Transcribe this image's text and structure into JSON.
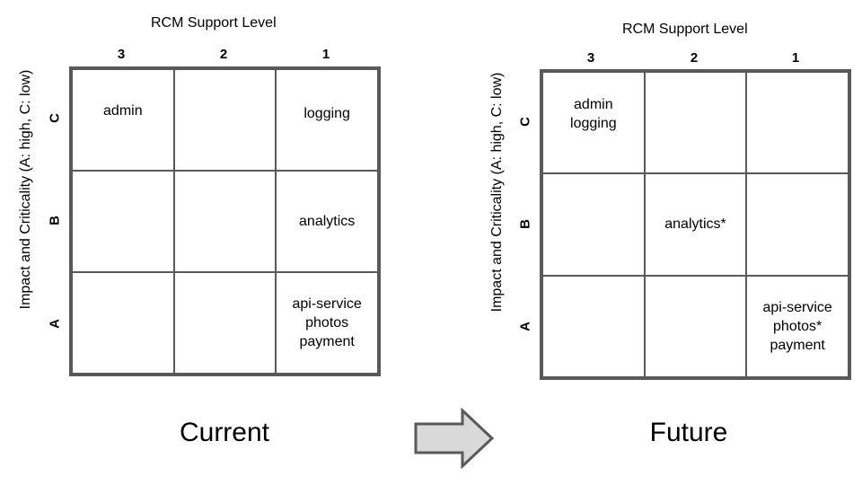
{
  "x_axis_title": "RCM Support Level",
  "y_axis_title": "Impact and Criticality (A: high, C: low)",
  "columns": [
    "3",
    "2",
    "1"
  ],
  "rows": [
    "C",
    "B",
    "A"
  ],
  "panels": [
    {
      "caption": "Current",
      "cells": [
        [
          [
            "admin"
          ],
          [],
          [
            "logging"
          ]
        ],
        [
          [],
          [],
          [
            "analytics"
          ]
        ],
        [
          [],
          [],
          [
            "api-service",
            "photos",
            "payment"
          ]
        ]
      ]
    },
    {
      "caption": "Future",
      "cells": [
        [
          [
            "admin",
            "logging"
          ],
          [],
          []
        ],
        [
          [],
          [
            "analytics*"
          ],
          []
        ],
        [
          [],
          [],
          [
            "api-service",
            "photos*",
            "payment"
          ]
        ]
      ]
    }
  ],
  "transition_arrow": {
    "icon": "right-arrow-icon",
    "fill": "#d9d9d9",
    "stroke": "#595959"
  },
  "colors": {
    "grid_line": "#595959",
    "text": "#000000",
    "background": "#ffffff"
  }
}
